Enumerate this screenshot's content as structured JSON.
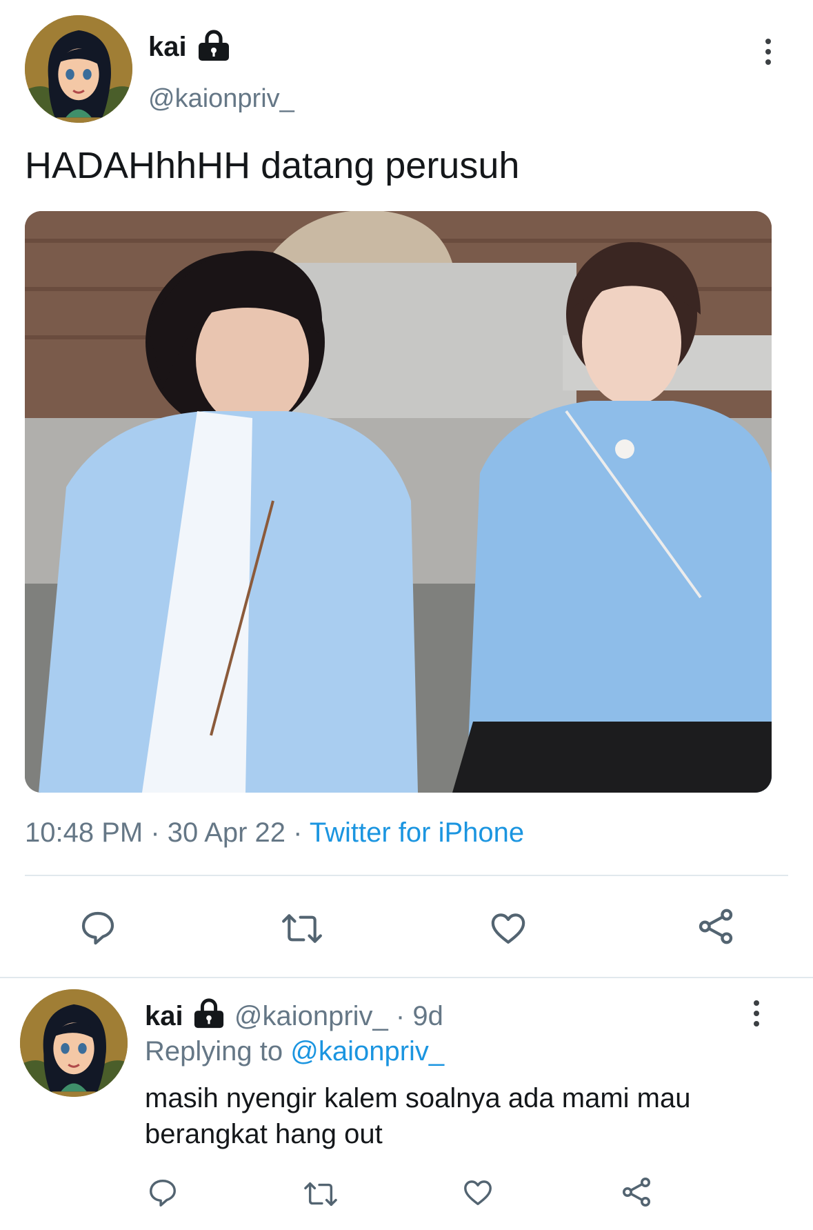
{
  "tweet": {
    "author_name": "kai",
    "handle": "@kaionpriv_",
    "text": "HADAHhhHH datang perusuh",
    "time": "10:48 PM",
    "date": "30 Apr 22",
    "source": "Twitter for iPhone",
    "separator": "·"
  },
  "reply": {
    "author_name": "kai",
    "handle": "@kaionpriv_",
    "age": "· 9d",
    "replying_label": "Replying to",
    "replying_handle": "@kaionpriv_",
    "text_line1": "masih nyengir kalem soalnya ada mami mau",
    "text_line2": "berangkat hang out"
  },
  "icons": {
    "lock": "lock-icon",
    "more": "more-vertical-icon",
    "reply": "reply-icon",
    "retweet": "retweet-icon",
    "like": "heart-icon",
    "share": "share-icon"
  },
  "colors": {
    "link": "#1b95e0",
    "muted": "#657786",
    "text": "#14171a",
    "divider": "#e1e8ed"
  }
}
